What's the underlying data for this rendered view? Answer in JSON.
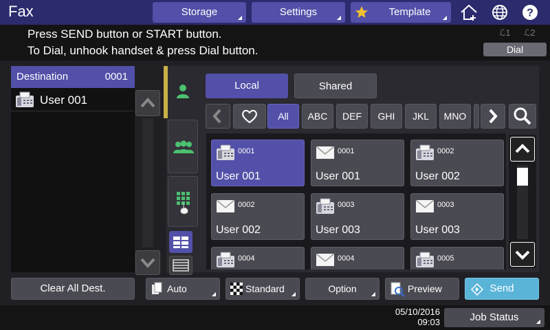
{
  "app": {
    "title": "Fax"
  },
  "topbar": {
    "storage": "Storage",
    "settings": "Settings",
    "template": "Template"
  },
  "message": {
    "line1": "Press SEND button or START button.",
    "line2": "To Dial, unhook handset & press Dial button.",
    "line1_indicator": "ℒ1",
    "line2_indicator": "ℒ2",
    "dial": "Dial"
  },
  "destination": {
    "header": "Destination",
    "count": "0001",
    "items": [
      {
        "name": "User 001",
        "icon": "fax-icon"
      }
    ]
  },
  "tabs": {
    "local": "Local",
    "shared": "Shared"
  },
  "index": [
    "All",
    "ABC",
    "DEF",
    "GHI",
    "JKL",
    "MNO"
  ],
  "cards": [
    {
      "num": "0001",
      "name": "User 001",
      "icon": "fax-icon",
      "selected": true
    },
    {
      "num": "0001",
      "name": "User 001",
      "icon": "mail-icon",
      "selected": false
    },
    {
      "num": "0002",
      "name": "User 002",
      "icon": "fax-icon",
      "selected": false
    },
    {
      "num": "0002",
      "name": "User 002",
      "icon": "mail-icon",
      "selected": false
    },
    {
      "num": "0003",
      "name": "User 003",
      "icon": "fax-icon",
      "selected": false
    },
    {
      "num": "0003",
      "name": "User 003",
      "icon": "mail-icon",
      "selected": false
    },
    {
      "num": "0004",
      "name": "",
      "icon": "fax-icon",
      "selected": false
    },
    {
      "num": "0004",
      "name": "",
      "icon": "mail-icon",
      "selected": false
    },
    {
      "num": "0005",
      "name": "",
      "icon": "fax-icon",
      "selected": false
    }
  ],
  "bottom": {
    "clear_all": "Clear All Dest.",
    "auto": "Auto",
    "standard": "Standard",
    "option": "Option",
    "preview": "Preview",
    "send": "Send"
  },
  "status": {
    "date": "05/10/2016",
    "time": "09:03",
    "job_status": "Job Status"
  },
  "colors": {
    "accent": "#5250a8",
    "send": "#5ab4d8",
    "tab_marker": "#c8b048"
  }
}
